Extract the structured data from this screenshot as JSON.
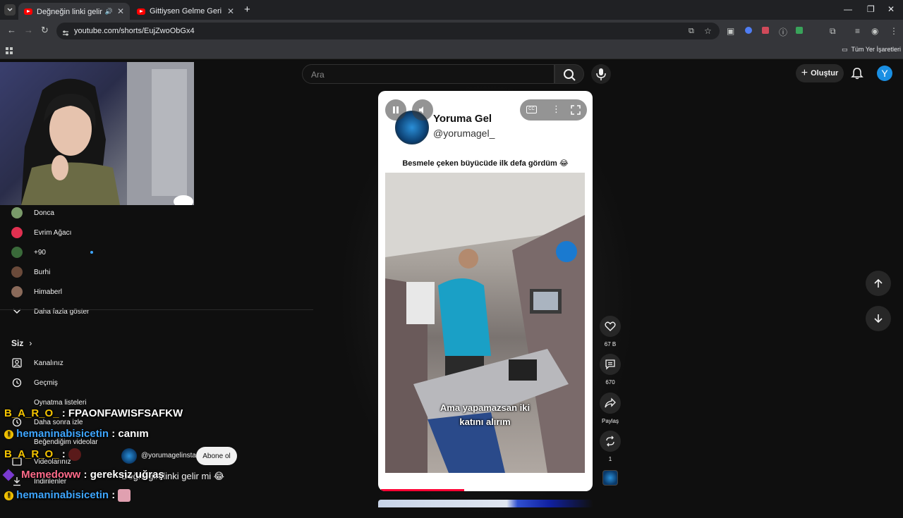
{
  "browser": {
    "tabs": [
      {
        "title": "Değneğin linki gelir mi 😂",
        "active": true
      },
      {
        "title": "Gittiysen Gelme Geri Kedi Versiy",
        "active": false
      }
    ],
    "url": "youtube.com/shorts/EujZwoObGx4",
    "bookmarks_label": "Tüm Yer İşaretleri"
  },
  "youtube": {
    "search_placeholder": "Ara",
    "create_label": "Oluştur",
    "avatar_letter": "Y",
    "sidebar": {
      "subscriptions": [
        {
          "label": "Donca",
          "color": "#7a9a6a"
        },
        {
          "label": "Evrim Ağacı",
          "color": "#e03050"
        },
        {
          "label": "+90",
          "color": "#3a6a3a"
        },
        {
          "label": "Burhi",
          "color": "#6a4a3a"
        },
        {
          "label": "Himaberl",
          "color": "#8a6a5a"
        }
      ],
      "show_more": "Daha fazla göster",
      "you_section": "Siz",
      "you_items": [
        {
          "label": "Kanalınız",
          "icon": "user-icon"
        },
        {
          "label": "Geçmiş",
          "icon": "history-icon"
        },
        {
          "label": "Oynatma listeleri",
          "icon": "playlist-icon"
        },
        {
          "label": "Daha sonra izle",
          "icon": "clock-icon"
        },
        {
          "label": "Beğendiğim videolar",
          "icon": "like-icon"
        },
        {
          "label": "Videolarınız",
          "icon": "video-icon"
        },
        {
          "label": "İndirilenler",
          "icon": "download-icon"
        }
      ]
    },
    "short": {
      "channel_name": "Yoruma Gel",
      "channel_handle": "@yorumagel_",
      "caption": "Besmele çeken büyücüde ilk defa gördüm 😂",
      "subtitle_line1": "Ama yapamazsan iki",
      "subtitle_line2": "katını alırım",
      "channel_overlay_handle": "@yorumagelinsta",
      "subscribe_label": "Abone ol",
      "title": "Değneğin linki gelir mi 😂",
      "progress": 0.4
    },
    "actions": {
      "likes": "67 B",
      "comments": "670",
      "share": "Paylaş",
      "remix": "1"
    }
  },
  "chat": [
    {
      "user": "B_A_R_O_",
      "message": "FPAONFAWISFSAFKW",
      "color": "#f5c400"
    },
    {
      "user": "hemaninabisicetin",
      "message": "canım",
      "color": "#3ea6ff"
    },
    {
      "user": "B_A_R_O_",
      "message": "",
      "color": "#f5c400"
    },
    {
      "user": "Memedoww",
      "message": "gereksiz uğraş",
      "color": "#ff6b8a"
    },
    {
      "user": "hemaninabisicetin",
      "message": "",
      "color": "#3ea6ff"
    }
  ]
}
